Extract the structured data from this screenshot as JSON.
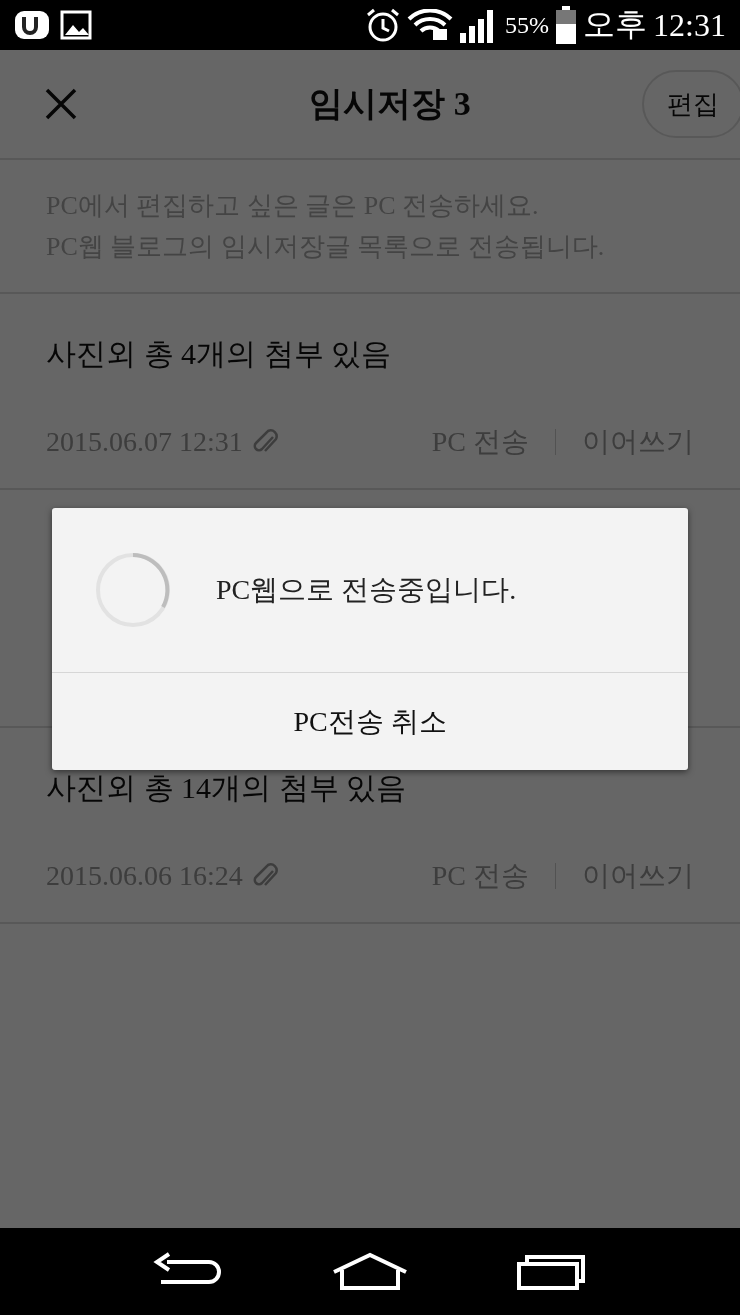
{
  "status_bar": {
    "battery": "55%",
    "ampm": "오후",
    "time": "12:31"
  },
  "header": {
    "title": "임시저장 3",
    "edit_button": "편집"
  },
  "notice": [
    "PC에서 편집하고 싶은 글은 PC 전송하세요.",
    "PC웹 블로그의 임시저장글 목록으로 전송됩니다."
  ],
  "items": [
    {
      "kind": "post",
      "title": "사진외 총 4개의 첨부 있음",
      "date": "2015.06.07 12:31",
      "attachment": true,
      "actions": [
        "PC 전송",
        "이어쓰기"
      ]
    },
    {
      "kind": "covered"
    },
    {
      "kind": "post",
      "title": "사진외 총 14개의 첨부 있음",
      "date": "2015.06.06 16:24",
      "attachment": true,
      "actions": [
        "PC 전송",
        "이어쓰기"
      ]
    }
  ],
  "dialog": {
    "message": "PC웹으로 전송중입니다.",
    "button": "PC전송 취소"
  }
}
